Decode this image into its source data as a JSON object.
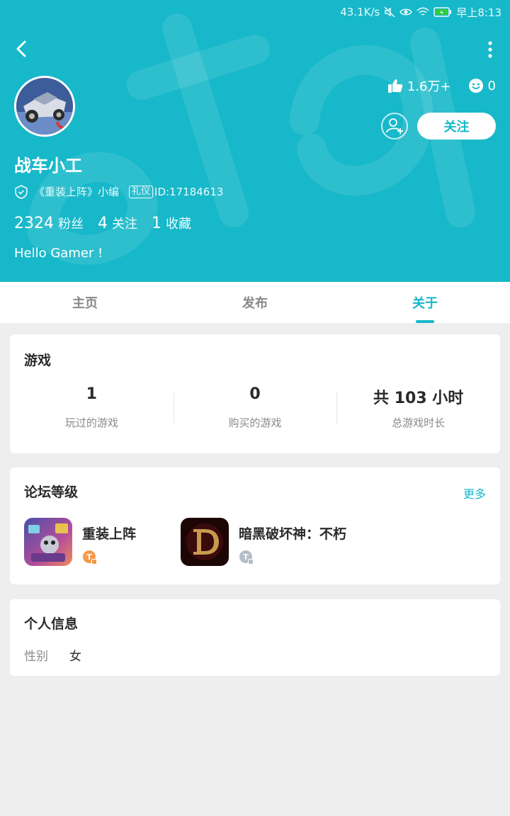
{
  "status_bar": {
    "speed": "43.1K/s",
    "time": "早上8:13"
  },
  "profile": {
    "username": "战车小工",
    "role_text": "《重装上阵》小编",
    "badge": "礼仪",
    "id_text": "ID:17184613",
    "likes": "1.6万+",
    "reactions": "0",
    "follow_label": "关注",
    "fans_count": "2324",
    "fans_label": "粉丝",
    "following_count": "4",
    "following_label": "关注",
    "favorites_count": "1",
    "favorites_label": "收藏",
    "bio": "Hello Gamer !"
  },
  "tabs": [
    {
      "label": "主页",
      "active": false
    },
    {
      "label": "发布",
      "active": false
    },
    {
      "label": "关于",
      "active": true
    }
  ],
  "games": {
    "title": "游戏",
    "stats": [
      {
        "value": "1",
        "label": "玩过的游戏"
      },
      {
        "value": "0",
        "label": "购买的游戏"
      },
      {
        "value": "共 103 小时",
        "label": "总游戏时长"
      }
    ]
  },
  "forum": {
    "title": "论坛等级",
    "more": "更多",
    "items": [
      {
        "name": "重装上阵"
      },
      {
        "name": "暗黑破坏神：不朽"
      }
    ]
  },
  "personal": {
    "title": "个人信息",
    "gender_label": "性别",
    "gender_value": "女"
  },
  "colors": {
    "accent": "#17b8c9",
    "background": "#eeeeee"
  }
}
